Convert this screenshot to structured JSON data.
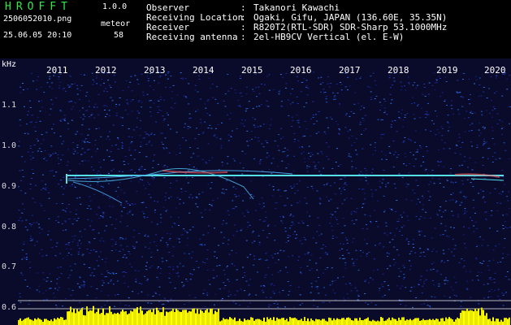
{
  "app": {
    "title": "HROFFT",
    "version": "1.0.0"
  },
  "file": {
    "name": "2506052010.png",
    "datetime": "25.06.05 20:10"
  },
  "counter": {
    "label": "meteor",
    "value": "58"
  },
  "info": [
    {
      "label": "Observer",
      "value": "Takanori Kawachi"
    },
    {
      "label": "Receiving Location",
      "value": "Ogaki, Gifu, JAPAN (136.60E, 35.35N)"
    },
    {
      "label": "Receiver",
      "value": "R820T2(RTL-SDR) SDR-Sharp 53.1000MHz"
    },
    {
      "label": "Receiving antenna",
      "value": "2el-HB9CV Vertical (el. E-W)"
    }
  ],
  "axis": {
    "y_unit": "kHz",
    "y_ticks": [
      "1.1",
      "1.0",
      "0.9",
      "0.8",
      "0.7",
      "0.6"
    ],
    "x_ticks": [
      "2011",
      "2012",
      "2013",
      "2014",
      "2015",
      "2016",
      "2017",
      "2018",
      "2019",
      "2020"
    ]
  },
  "colors": {
    "background": "#000000",
    "noise": "#1a2a9a",
    "trace": "#55e0e8",
    "bars": "#ffff00",
    "title": "#2fe84a"
  }
}
